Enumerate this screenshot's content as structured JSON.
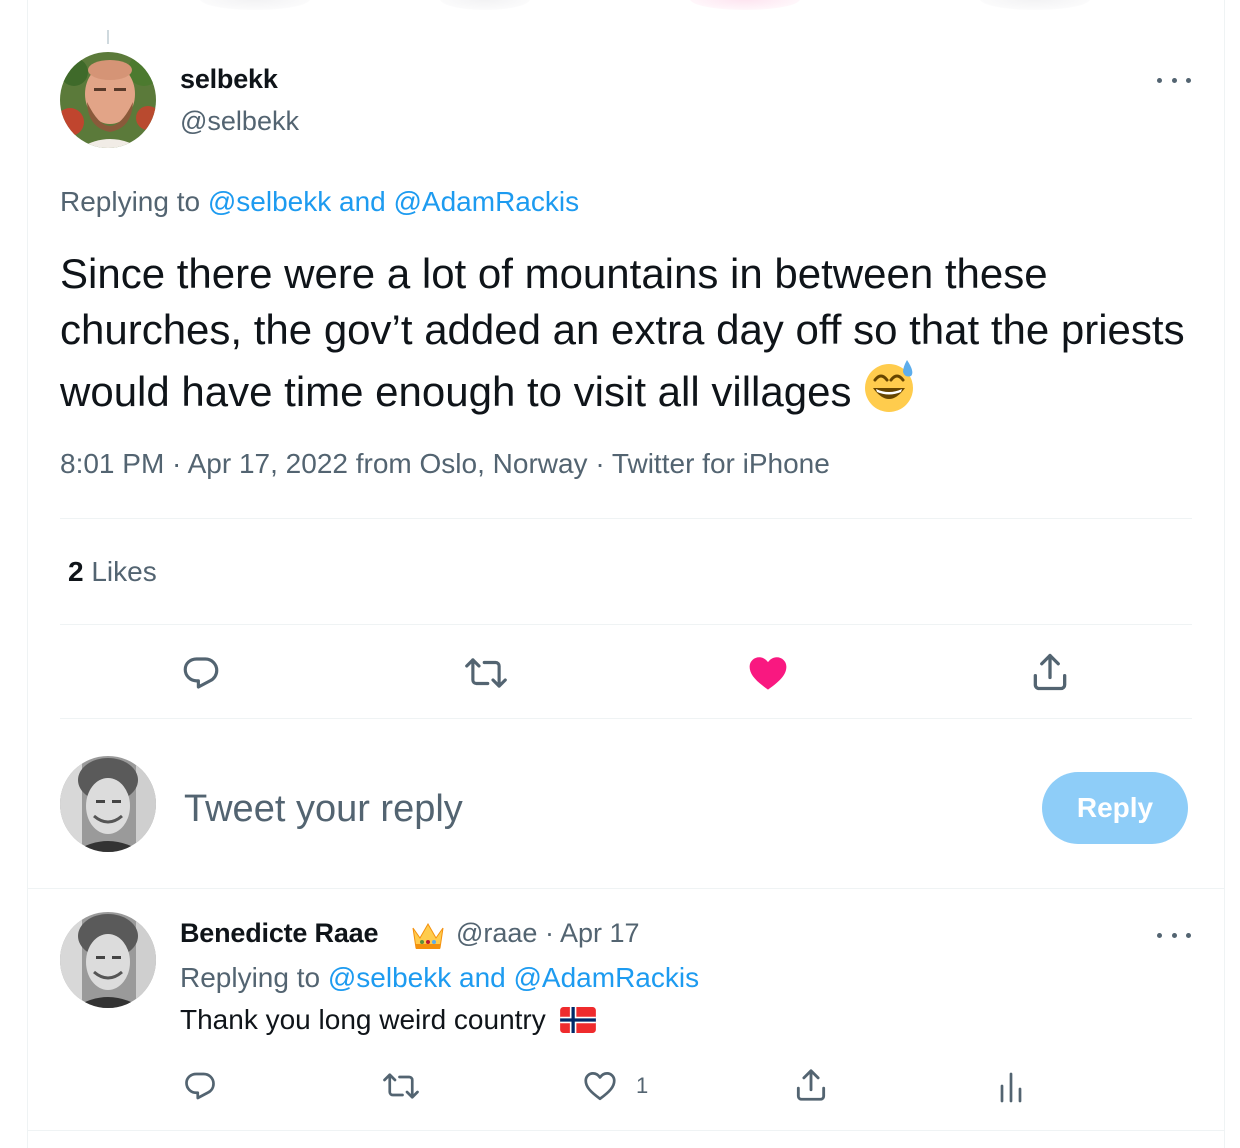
{
  "main_tweet": {
    "display_name": "selbekk",
    "handle": "@selbekk",
    "replying_prefix": "Replying to ",
    "replying_users": "@selbekk and @AdamRackis",
    "text": "Since there were a lot of mountains in between these churches, the gov’t added an extra day off so that the priests would have time enough to visit all villages",
    "emoji": "sweat-smile-emoji",
    "meta": "8:01 PM · Apr 17, 2022 from Oslo, Norway · Twitter for iPhone",
    "likes_count": "2",
    "likes_label": " Likes",
    "actions": {
      "reply_icon": "reply-icon",
      "retweet_icon": "retweet-icon",
      "like_icon": "heart-filled-icon",
      "share_icon": "share-icon"
    },
    "like_color": "#f91880"
  },
  "compose": {
    "placeholder": "Tweet your reply",
    "button_label": "Reply"
  },
  "reply_tweet": {
    "display_name": "Benedicte Raae",
    "badge_icon": "crown-emoji",
    "handle_and_date": "@raae · Apr 17",
    "replying_prefix": "Replying to ",
    "replying_users": "@selbekk and @AdamRackis",
    "text": "Thank you long weird country",
    "flag": "norway-flag-emoji",
    "like_count": "1"
  },
  "colors": {
    "accent": "#1d9bf0",
    "secondary_text": "#536471",
    "reply_button_disabled": "#8ecdf8"
  }
}
